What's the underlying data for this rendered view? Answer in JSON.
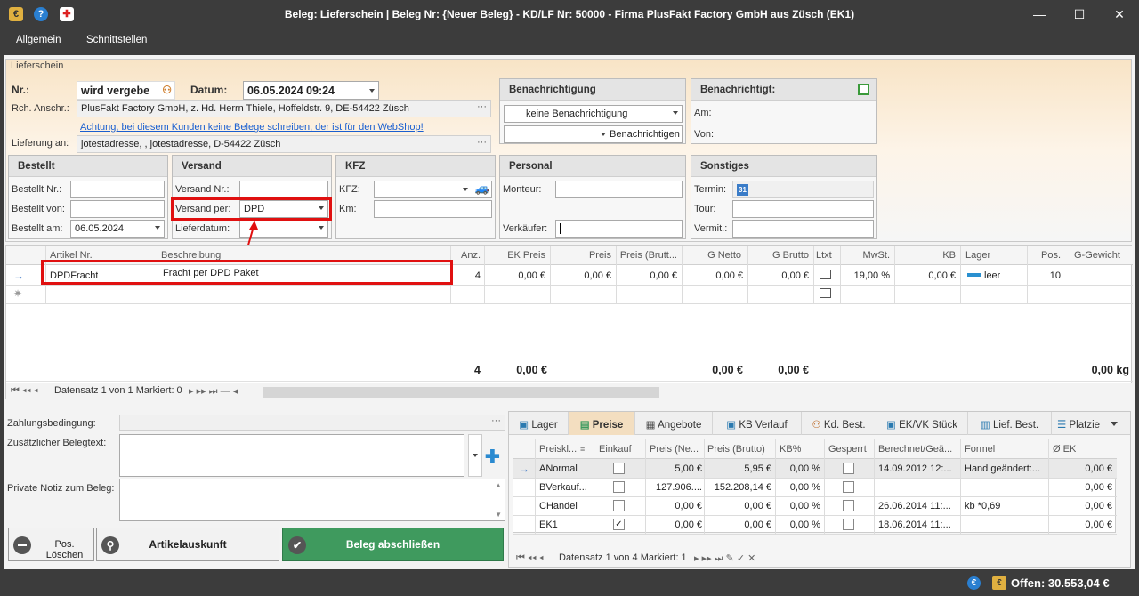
{
  "window": {
    "title": "Beleg: Lieferschein | Beleg Nr: {Neuer Beleg} - KD/LF Nr: 50000 - Firma PlusFakt Factory GmbH aus Züsch (EK1)",
    "minimize": "—",
    "maximize": "☐",
    "close": "✕"
  },
  "menu": {
    "items": [
      "Allgemein",
      "Schnittstellen"
    ]
  },
  "lieferschein": {
    "legend": "Lieferschein",
    "nr_label": "Nr.:",
    "nr_value": "wird vergebe",
    "datum_label": "Datum:",
    "datum_value": "06.05.2024 09:24",
    "rch_label": "Rch. Anschr.:",
    "rch_value": "PlusFakt Factory GmbH, z. Hd. Herrn Thiele, Hoffeldstr. 9,  DE-54422 Züsch",
    "warning_link": "Achtung, bei diesem Kunden keine Belege schreiben, der ist für den WebShop!",
    "lieferung_label": "Lieferung an:",
    "lieferung_value": "jotestadresse, , jotestadresse,  D-54422 Züsch"
  },
  "benachrichtigung": {
    "title": "Benachrichtigung",
    "select_value": "keine Benachrichtigung",
    "button_label": "Benachrichtigen"
  },
  "benachrichtigt": {
    "title": "Benachrichtigt:",
    "am_label": "Am:",
    "von_label": "Von:"
  },
  "bestellt": {
    "title": "Bestellt",
    "nr_label": "Bestellt Nr.:",
    "von_label": "Bestellt von:",
    "am_label": "Bestellt am:",
    "am_value": "06.05.2024"
  },
  "versand": {
    "title": "Versand",
    "nr_label": "Versand Nr.:",
    "per_label": "Versand per:",
    "per_value": "DPD",
    "datum_label": "Lieferdatum:"
  },
  "kfz": {
    "title": "KFZ",
    "kfz_label": "KFZ:",
    "km_label": "Km:"
  },
  "personal": {
    "title": "Personal",
    "monteur_label": "Monteur:",
    "verkaeufer_label": "Verkäufer:"
  },
  "sonstiges": {
    "title": "Sonstiges",
    "termin_label": "Termin:",
    "tour_label": "Tour:",
    "vermit_label": "Vermit.:",
    "calendar_day": "31"
  },
  "positions": {
    "headers": [
      "Artikel Nr.",
      "Beschreibung",
      "Anz.",
      "EK Preis",
      "Preis",
      "Preis (Brutt...",
      "G Netto",
      "G Brutto",
      "Ltxt",
      "MwSt.",
      "KB",
      "Lager",
      "Pos.",
      "G-Gewicht"
    ],
    "row": {
      "artikel": "DPDFracht",
      "beschreibung": "Fracht per DPD Paket",
      "anz": "4",
      "ek_preis": "0,00 €",
      "preis": "0,00 €",
      "preis_brutto": "0,00 €",
      "g_netto": "0,00 €",
      "g_brutto": "0,00 €",
      "mwst": "19,00 %",
      "kb": "0,00 €",
      "lager": "leer",
      "pos": "10"
    },
    "totals": {
      "anz": "4",
      "ek_preis": "0,00 €",
      "g_netto": "0,00 €",
      "g_brutto": "0,00 €",
      "g_gewicht": "0,00 kg"
    },
    "nav": "Datensatz 1 von 1 Markiert: 0"
  },
  "bottom_left": {
    "zahlung_label": "Zahlungsbedingung:",
    "beleg_text_label": "Zusätzlicher Belegtext:",
    "notiz_label": "Private Notiz zum Beleg:",
    "pos_loeschen": "Pos. Löschen",
    "artikelauskunft": "Artikelauskunft",
    "beleg_abschliessen": "Beleg abschließen"
  },
  "tabs": [
    "Lager",
    "Preise",
    "Angebote",
    "KB Verlauf",
    "Kd. Best.",
    "EK/VK Stück",
    "Lief. Best.",
    "Platzie"
  ],
  "preise": {
    "headers": [
      "Preiskl...",
      "Einkauf",
      "Preis (Ne...",
      "Preis (Brutto)",
      "KB%",
      "Gesperrt",
      "Berechnet/Geä...",
      "Formel",
      "Ø EK"
    ],
    "rows": [
      {
        "klasse": "ANormal",
        "einkauf": false,
        "netto": "5,00 €",
        "brutto": "5,95 €",
        "kb": "0,00 %",
        "gesperrt": false,
        "berechnet": "14.09.2012 12:...",
        "formel": "Hand geändert:...",
        "ek": "0,00 €"
      },
      {
        "klasse": "BVerkauf...",
        "einkauf": false,
        "netto": "127.906....",
        "brutto": "152.208,14 €",
        "kb": "0,00 %",
        "gesperrt": false,
        "berechnet": "",
        "formel": "",
        "ek": "0,00 €"
      },
      {
        "klasse": "CHandel",
        "einkauf": false,
        "netto": "0,00 €",
        "brutto": "0,00 €",
        "kb": "0,00 %",
        "gesperrt": false,
        "berechnet": "26.06.2014 11:...",
        "formel": "kb *0,69",
        "ek": "0,00 €"
      },
      {
        "klasse": "EK1",
        "einkauf": true,
        "netto": "0,00 €",
        "brutto": "0,00 €",
        "kb": "0,00 %",
        "gesperrt": false,
        "berechnet": "18.06.2014 11:...",
        "formel": "",
        "ek": "0,00 €"
      }
    ],
    "nav": "Datensatz 1 von 4 Markiert: 1"
  },
  "status": {
    "offen": "Offen: 30.553,04 €"
  },
  "colors": {
    "accent_green": "#3f9a5e",
    "highlight_red": "#e01010",
    "title_bg": "#3c3c3c",
    "header_gradient": "#f7e1c2"
  }
}
